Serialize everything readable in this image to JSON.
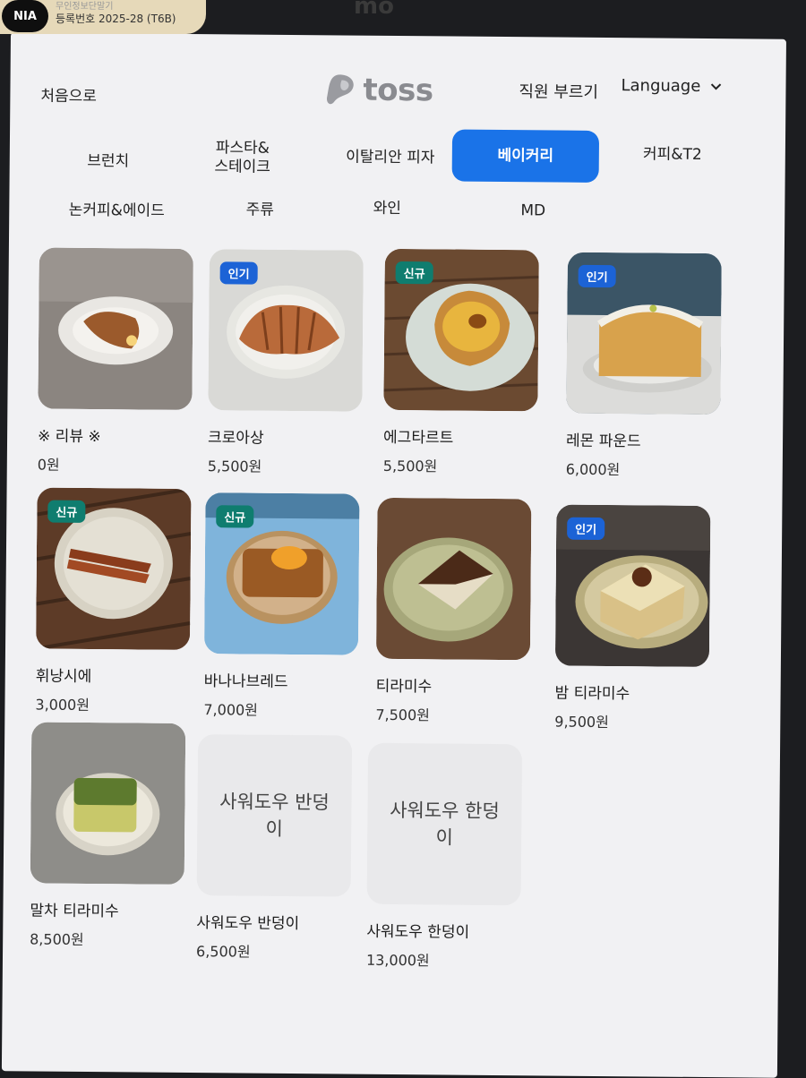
{
  "sticker": {
    "badge": "NIA",
    "faded_line": "무인정보단말기",
    "registration": "등록번호 2025-28 (T6B)"
  },
  "frame": {
    "top_text": "mo"
  },
  "header": {
    "home_label": "처음으로",
    "logo_text": "toss",
    "staff_call_label": "직원 부르기",
    "language_label": "Language"
  },
  "categories": [
    {
      "label": "브런치"
    },
    {
      "label": "파스타&\n스테이크"
    },
    {
      "label": "이탈리안 피자"
    },
    {
      "label": "베이커리"
    },
    {
      "label": "커피&T2"
    },
    {
      "label": "논커피&에이드"
    },
    {
      "label": "주류"
    },
    {
      "label": "와인"
    },
    {
      "label": "MD"
    }
  ],
  "active_category": "베이커리",
  "products": [
    {
      "name": "※ 리뷰 ※",
      "price": "0원",
      "badge": ""
    },
    {
      "name": "크로아상",
      "price": "5,500원",
      "badge": "인기"
    },
    {
      "name": "에그타르트",
      "price": "5,500원",
      "badge": "신규"
    },
    {
      "name": "레몬 파운드",
      "price": "6,000원",
      "badge": "인기"
    },
    {
      "name": "휘낭시에",
      "price": "3,000원",
      "badge": "신규"
    },
    {
      "name": "바나나브레드",
      "price": "7,000원",
      "badge": "신규"
    },
    {
      "name": "티라미수",
      "price": "7,500원",
      "badge": ""
    },
    {
      "name": "밤 티라미수",
      "price": "9,500원",
      "badge": "인기"
    },
    {
      "name": "말차 티라미수",
      "price": "8,500원",
      "badge": ""
    },
    {
      "name": "사워도우 반덩이",
      "price": "6,500원",
      "badge": "",
      "placeholder_text": "사워도우 반덩\n이"
    },
    {
      "name": "사워도우 한덩이",
      "price": "13,000원",
      "badge": "",
      "placeholder_text": "사워도우 한덩\n이"
    }
  ],
  "colors": {
    "accent": "#1a73e8",
    "badge_popular": "#1c63d6",
    "badge_new": "#0f7d6f",
    "screen_bg": "#f1f1f3"
  }
}
